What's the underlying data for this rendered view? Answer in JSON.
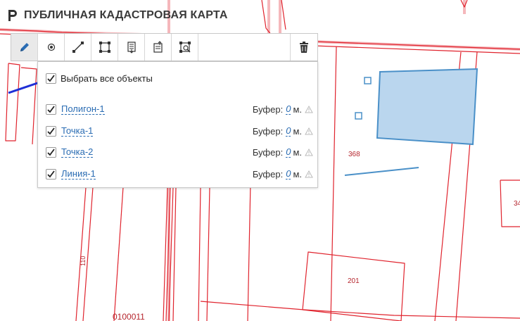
{
  "header": {
    "title": "ПУБЛИЧНАЯ КАДАСТРОВАЯ КАРТА",
    "logo_icon": "cadastral-logo-icon"
  },
  "toolbar": {
    "buttons": [
      {
        "name": "draw-pencil-button",
        "icon": "pencil-icon",
        "active": true
      },
      {
        "name": "point-tool-button",
        "icon": "point-icon"
      },
      {
        "name": "line-tool-button",
        "icon": "line-icon"
      },
      {
        "name": "polygon-tool-button",
        "icon": "polygon-icon"
      },
      {
        "name": "object-list-button",
        "icon": "list-icon"
      },
      {
        "name": "import-button",
        "icon": "import-icon"
      },
      {
        "name": "area-search-button",
        "icon": "area-search-icon"
      },
      {
        "name": "delete-button",
        "icon": "trash-icon"
      }
    ]
  },
  "panel": {
    "select_all_label": "Выбрать все объекты",
    "select_all_checked": true,
    "buffer_label": "Буфер:",
    "unit": "м.",
    "objects": [
      {
        "name": "Полигон-1",
        "buffer": "0",
        "checked": true
      },
      {
        "name": "Точка-1",
        "buffer": "0",
        "checked": true
      },
      {
        "name": "Точка-2",
        "buffer": "0",
        "checked": true
      },
      {
        "name": "Линия-1",
        "buffer": "0",
        "checked": true
      }
    ]
  },
  "map": {
    "parcel_labels": [
      "368",
      "201",
      "110",
      "0100011",
      "34"
    ],
    "colors": {
      "parcel_border": "#e0232d",
      "drawn_feature": "#4a90c8",
      "polygon_fill": "#bad6ee",
      "arrow": "#1f2fd6"
    }
  }
}
